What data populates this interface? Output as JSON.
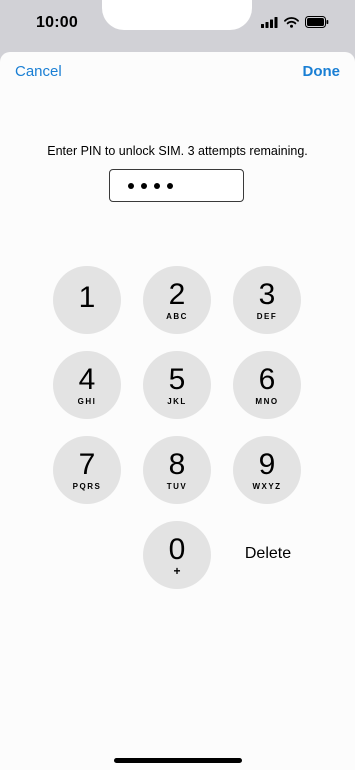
{
  "status_bar": {
    "time": "10:00",
    "icons": [
      "signal-icon",
      "wifi-icon",
      "battery-icon"
    ]
  },
  "nav": {
    "cancel_label": "Cancel",
    "done_label": "Done"
  },
  "prompt": "Enter PIN to unlock SIM. 3 attempts remaining.",
  "pin": {
    "entered_digits": 4
  },
  "keypad": {
    "keys": [
      {
        "digit": "1",
        "letters": ""
      },
      {
        "digit": "2",
        "letters": "ABC"
      },
      {
        "digit": "3",
        "letters": "DEF"
      },
      {
        "digit": "4",
        "letters": "GHI"
      },
      {
        "digit": "5",
        "letters": "JKL"
      },
      {
        "digit": "6",
        "letters": "MNO"
      },
      {
        "digit": "7",
        "letters": "PQRS"
      },
      {
        "digit": "8",
        "letters": "TUV"
      },
      {
        "digit": "9",
        "letters": "WXYZ"
      },
      {
        "digit": "0",
        "letters": "+"
      }
    ],
    "delete_label": "Delete"
  },
  "colors": {
    "accent": "#1a7fd4",
    "key_background": "#e3e3e3",
    "backdrop": "#d1d1d6"
  }
}
